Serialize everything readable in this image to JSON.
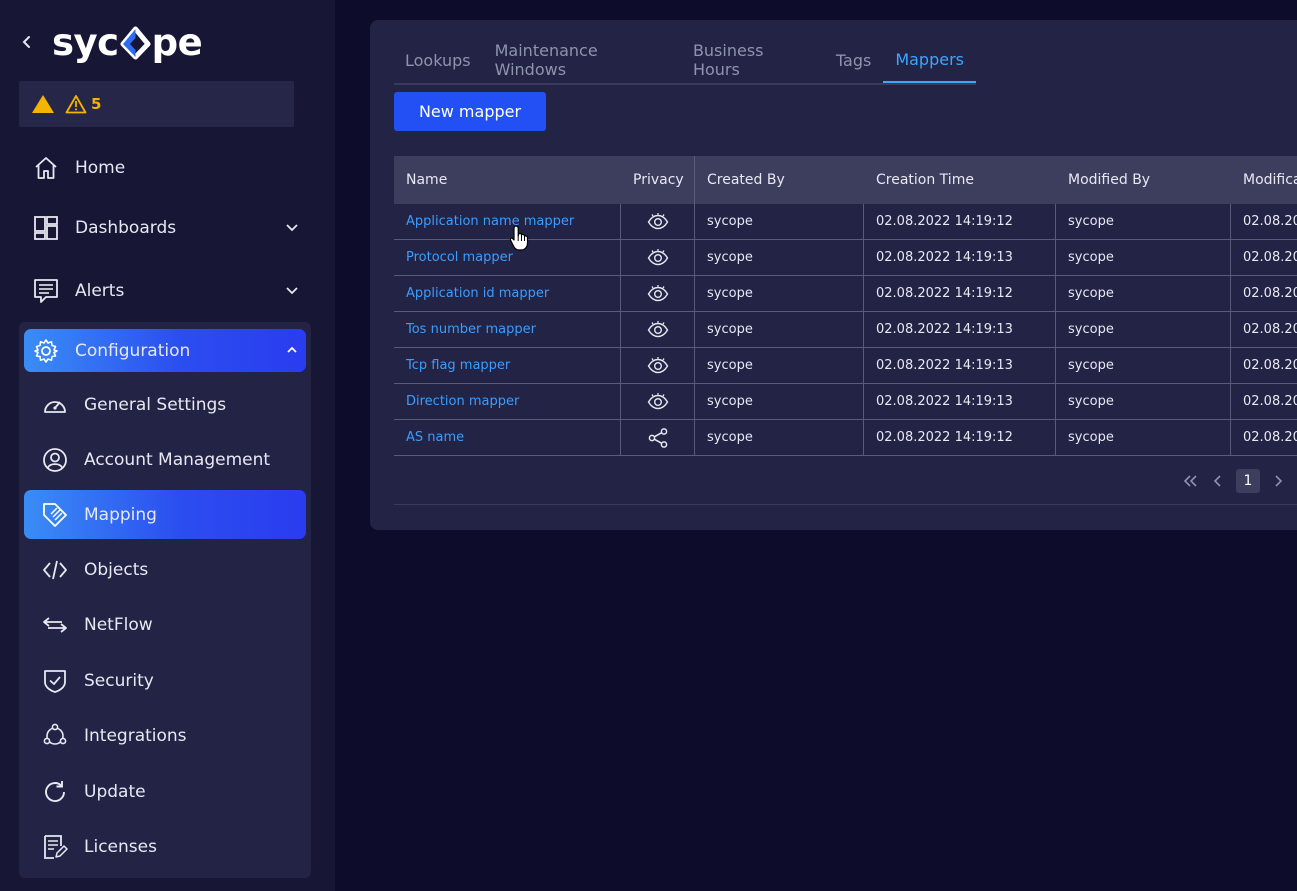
{
  "app": {
    "logo_text_left": "syc",
    "logo_text_right": "pe"
  },
  "alerts": {
    "count": "5"
  },
  "nav": {
    "home": "Home",
    "dashboards": "Dashboards",
    "alerts": "Alerts",
    "configuration": "Configuration"
  },
  "config_items": [
    {
      "label": "General Settings",
      "icon": "gauge-icon"
    },
    {
      "label": "Account Management",
      "icon": "user-circle-icon"
    },
    {
      "label": "Mapping",
      "icon": "tag-icon"
    },
    {
      "label": "Objects",
      "icon": "code-icon"
    },
    {
      "label": "NetFlow",
      "icon": "arrows-icon"
    },
    {
      "label": "Security",
      "icon": "shield-icon"
    },
    {
      "label": "Integrations",
      "icon": "integrations-icon"
    },
    {
      "label": "Update",
      "icon": "refresh-icon"
    },
    {
      "label": "Licenses",
      "icon": "license-icon"
    }
  ],
  "tabs": [
    "Lookups",
    "Maintenance Windows",
    "Business Hours",
    "Tags",
    "Mappers"
  ],
  "active_tab": "Mappers",
  "new_button": "New mapper",
  "table": {
    "headers": [
      "Name",
      "Privacy",
      "Created By",
      "Creation Time",
      "Modified By",
      "Modifica"
    ],
    "rows": [
      {
        "name": "Application name mapper",
        "privacy": "eye",
        "created_by": "sycope",
        "creation_time": "02.08.2022 14:19:12",
        "modified_by": "sycope",
        "modified": "02.08.20"
      },
      {
        "name": "Protocol mapper",
        "privacy": "eye",
        "created_by": "sycope",
        "creation_time": "02.08.2022 14:19:13",
        "modified_by": "sycope",
        "modified": "02.08.20"
      },
      {
        "name": "Application id mapper",
        "privacy": "eye",
        "created_by": "sycope",
        "creation_time": "02.08.2022 14:19:12",
        "modified_by": "sycope",
        "modified": "02.08.20"
      },
      {
        "name": "Tos number mapper",
        "privacy": "eye",
        "created_by": "sycope",
        "creation_time": "02.08.2022 14:19:13",
        "modified_by": "sycope",
        "modified": "02.08.20"
      },
      {
        "name": "Tcp flag mapper",
        "privacy": "eye",
        "created_by": "sycope",
        "creation_time": "02.08.2022 14:19:13",
        "modified_by": "sycope",
        "modified": "02.08.20"
      },
      {
        "name": "Direction mapper",
        "privacy": "eye",
        "created_by": "sycope",
        "creation_time": "02.08.2022 14:19:13",
        "modified_by": "sycope",
        "modified": "02.08.20"
      },
      {
        "name": "AS name",
        "privacy": "share",
        "created_by": "sycope",
        "creation_time": "02.08.2022 14:19:12",
        "modified_by": "sycope",
        "modified": "02.08.20"
      }
    ]
  },
  "pagination": {
    "current_page": "1"
  },
  "colors": {
    "accent": "#2250f5",
    "link": "#3a9dff",
    "warning": "#f5b400",
    "background": "#0d0d2b"
  }
}
